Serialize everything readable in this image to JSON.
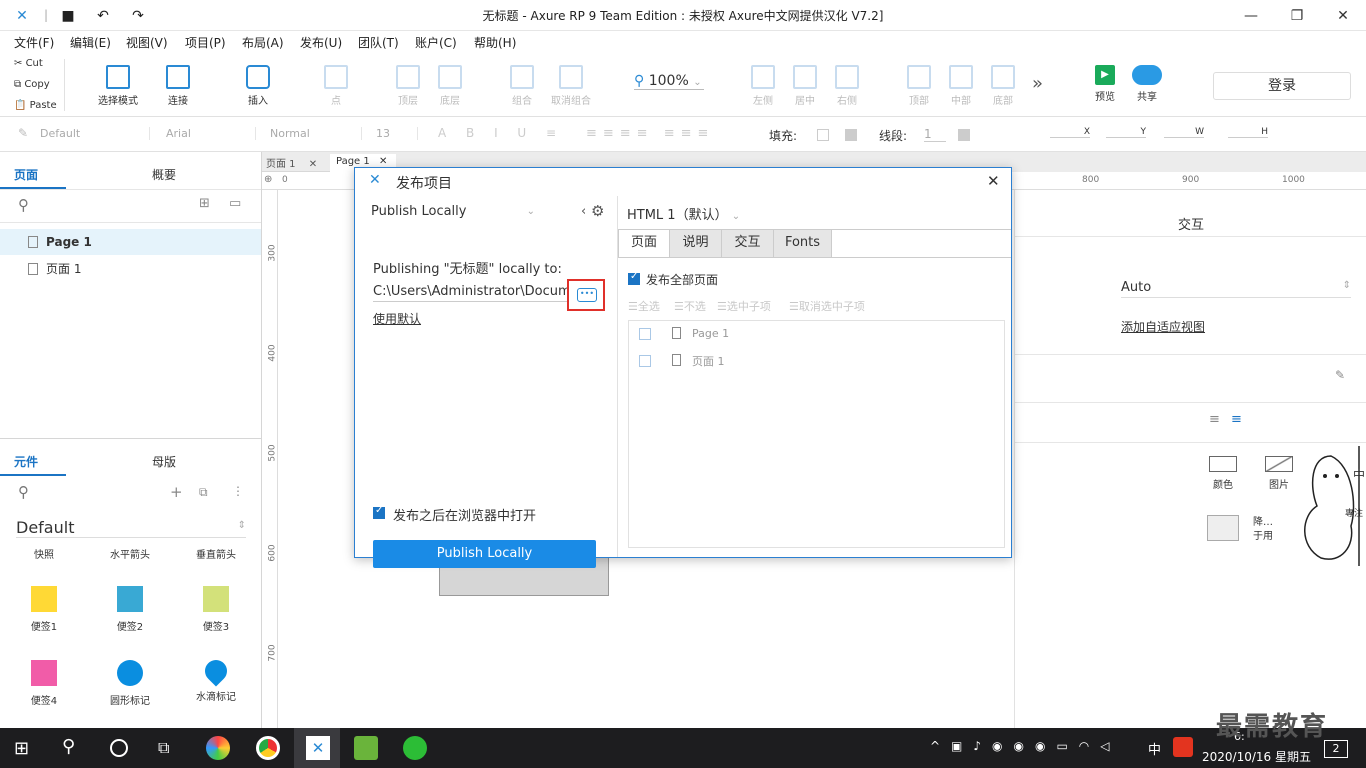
{
  "titlebar": {
    "title": "无标题 - Axure RP 9 Team Edition : 未授权    Axure中文网提供汉化 V7.2]"
  },
  "menu": [
    "文件(F)",
    "编辑(E)",
    "视图(V)",
    "项目(P)",
    "布局(A)",
    "发布(U)",
    "团队(T)",
    "账户(C)",
    "帮助(H)"
  ],
  "clipboard": {
    "cut": "Cut",
    "copy": "Copy",
    "paste": "Paste"
  },
  "toolbar": {
    "select": "选择模式",
    "connect": "连接",
    "insert": "插入",
    "point": "点",
    "top": "顶层",
    "bottom": "底层",
    "group": "组合",
    "ungroup": "取消组合",
    "zoom": "100%",
    "left": "左侧",
    "center": "居中",
    "right": "右侧",
    "vtop": "顶部",
    "middle": "中部",
    "vbottom": "底部",
    "more": "»",
    "preview": "预览",
    "share": "共享",
    "login": "登录"
  },
  "format": {
    "style": "Default",
    "font": "Arial",
    "weight": "Normal",
    "size": "13",
    "fill": "填充:",
    "stroke": "线段:",
    "stroke_val": "1",
    "x": "X",
    "y": "Y",
    "w": "W",
    "h": "H"
  },
  "pages": {
    "tab_pages": "页面",
    "tab_outline": "概要",
    "items": [
      "Page 1",
      "页面 1"
    ]
  },
  "widgets": {
    "tab_lib": "元件",
    "tab_master": "母版",
    "library": "Default",
    "row0": [
      "快照",
      "水平箭头",
      "垂直箭头"
    ],
    "row1": [
      "便签1",
      "便签2",
      "便签3"
    ],
    "row2": [
      "便签4",
      "圆形标记",
      "水滴标记"
    ]
  },
  "canvas": {
    "tabs": [
      "页面 1",
      "Page 1"
    ],
    "ruler": [
      "0",
      "800",
      "900",
      "1000"
    ],
    "vruler": [
      "300",
      "400",
      "500",
      "600",
      "700"
    ]
  },
  "dialog": {
    "title": "发布项目",
    "mode": "Publish Locally",
    "publishing": "Publishing \"无标题\" locally to:",
    "path": "C:\\Users\\Administrator\\Docume",
    "use_default": "使用默认",
    "open_browser": "发布之后在浏览器中打开",
    "button": "Publish Locally",
    "profile": "HTML 1（默认）",
    "tabs": [
      "页面",
      "说明",
      "交互",
      "Fonts"
    ],
    "publish_all": "发布全部页面",
    "actions": [
      "全选",
      "不选",
      "选中子项",
      "取消选中子项"
    ],
    "pages": [
      "Page 1",
      "页面 1"
    ]
  },
  "right": {
    "header": "交互",
    "adaptive": "Auto",
    "add_view": "添加自适应视图",
    "swatches": [
      "颜色",
      "图片"
    ],
    "side_text": [
      "中",
      "專注",
      "降…",
      "于用"
    ]
  },
  "taskbar": {
    "time": "6:",
    "date": "2020/10/16 星期五",
    "ime": "中",
    "badge": "2",
    "watermark": "最需教育"
  },
  "colors": {
    "accent": "#1b74c4",
    "primary_btn": "#1a8be6",
    "highlight": "#e0302a"
  }
}
